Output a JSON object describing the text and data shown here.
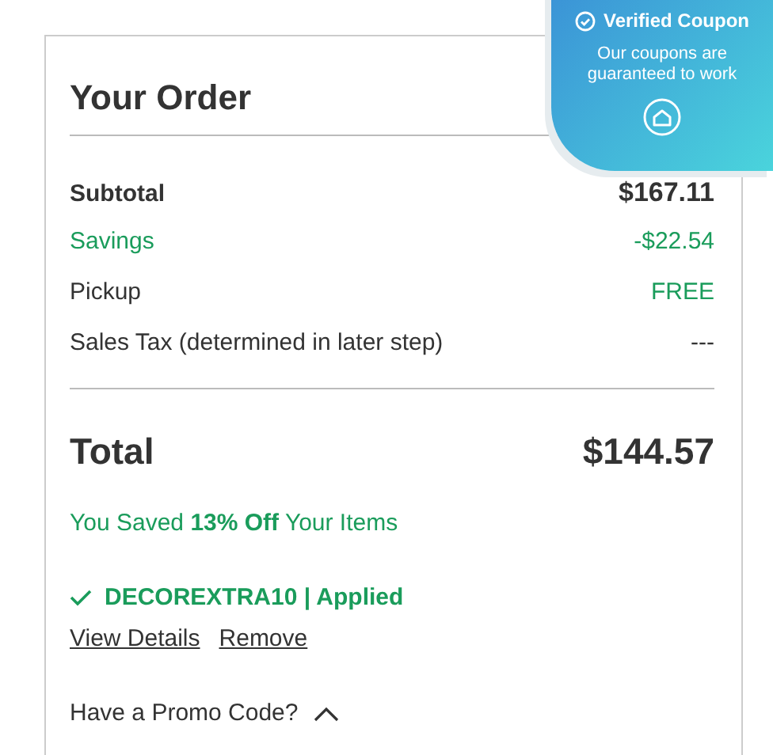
{
  "title": "Your Order",
  "lines": [
    {
      "label": "Subtotal",
      "value": "$167.11",
      "kind": "bold"
    },
    {
      "label": "Savings",
      "value": "-$22.54",
      "kind": "savings"
    },
    {
      "label": "Pickup",
      "value": "FREE",
      "kind": "savings-value"
    },
    {
      "label": "Sales Tax (determined in later step)",
      "value": "---",
      "kind": "plain"
    }
  ],
  "total": {
    "label": "Total",
    "value": "$144.57"
  },
  "saved_message": "You Saved **13% Off** Your Items",
  "coupon": {
    "code": "DECOREXTRA10 | Applied",
    "applied": true
  },
  "links": [
    "View Details",
    "Remove"
  ],
  "promo": {
    "label": "Have a Promo Code?",
    "expanded": true
  },
  "badge": {
    "title": "Verified Coupon",
    "text": "Our coupons are guaranteed to work"
  }
}
